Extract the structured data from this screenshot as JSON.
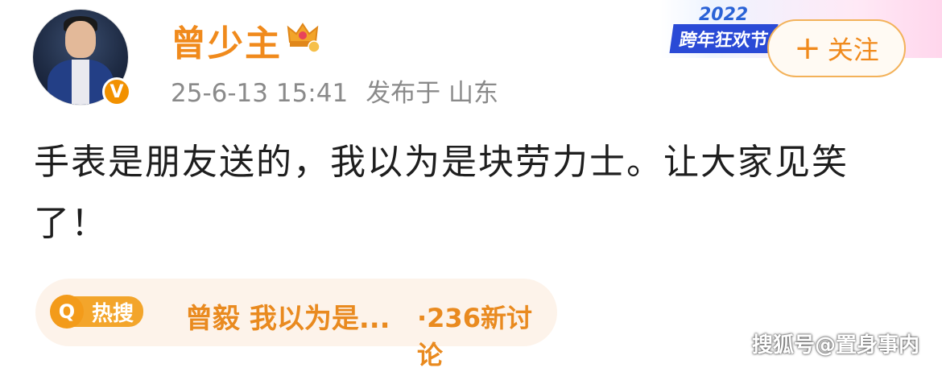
{
  "header": {
    "username": "曾少主",
    "timestamp": "25-6-13 15:41",
    "location": "发布于 山东",
    "banner_year": "2022",
    "banner_tag": "跨年狂欢节",
    "follow_label": "关注"
  },
  "post": {
    "text": "手表是朋友送的，我以为是块劳力士。让大家见笑了！"
  },
  "hot_search": {
    "label": "热搜",
    "topic": "曾毅 我以为是...",
    "count": "·236新讨论"
  },
  "watermark": "搜狐号@置身事内",
  "colors": {
    "accent": "#f08a1c",
    "meta": "#8a8a8a",
    "verified": "#f29100"
  },
  "icons": {
    "verified": "verified-badge-icon",
    "crown": "crown-icon",
    "search": "search-icon",
    "plus": "plus-icon"
  }
}
